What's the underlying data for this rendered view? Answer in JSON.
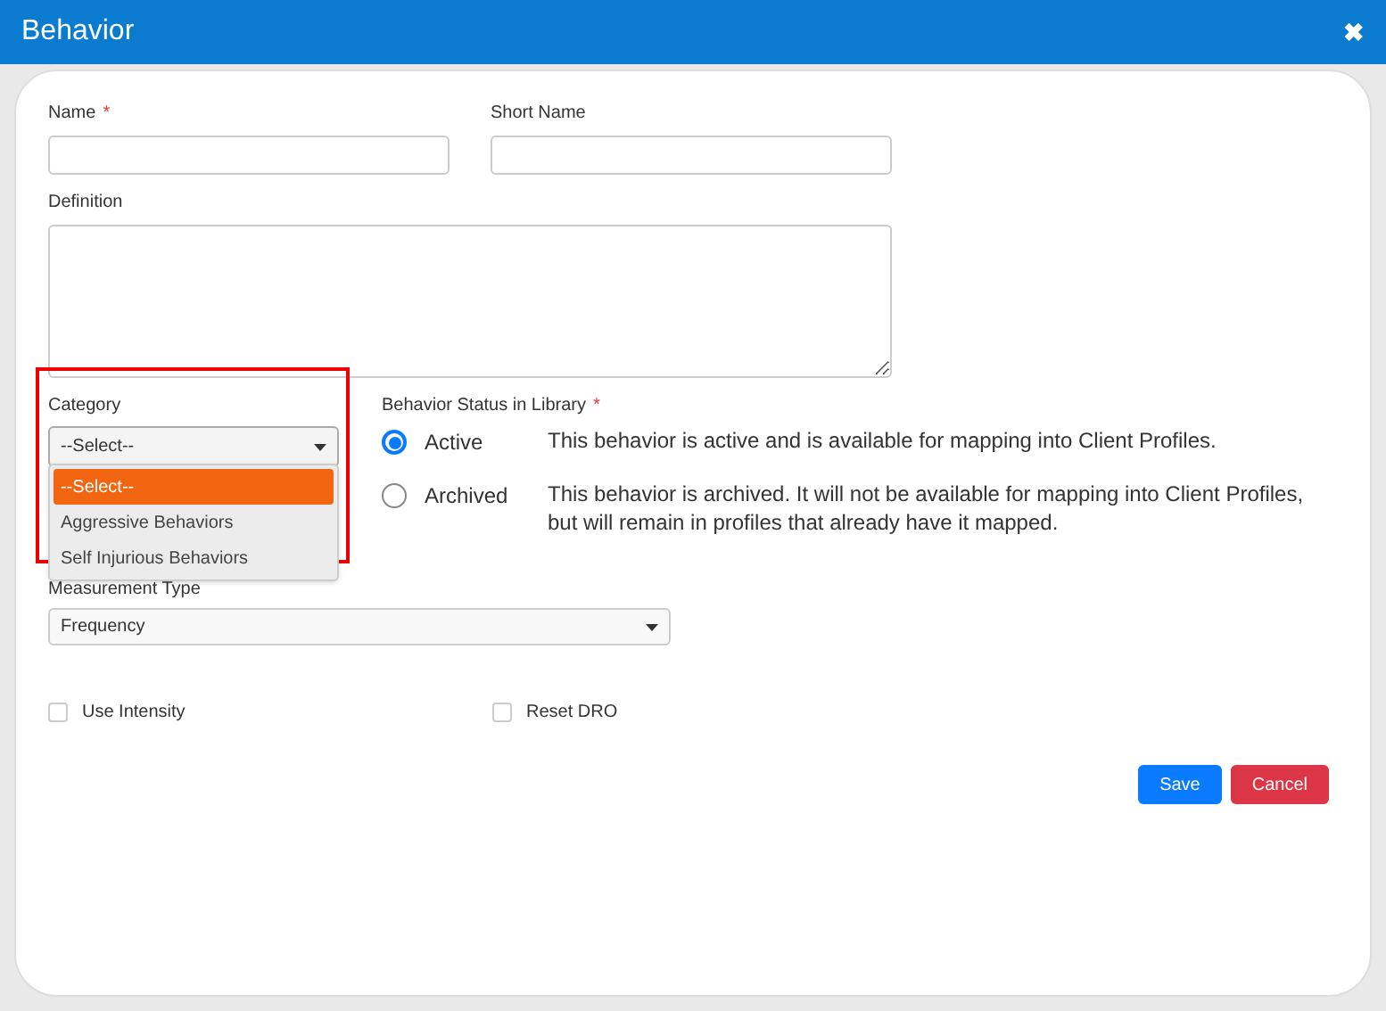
{
  "window": {
    "title": "Behavior",
    "close": "✖"
  },
  "fields": {
    "name": {
      "label": "Name",
      "required_mark": "*"
    },
    "short_name": {
      "label": "Short Name"
    },
    "definition": {
      "label": "Definition"
    }
  },
  "category": {
    "label": "Category",
    "value": "--Select--",
    "expanded": true,
    "options": [
      {
        "label": "--Select--",
        "selected": true
      },
      {
        "label": "Aggressive Behaviors",
        "selected": false
      },
      {
        "label": "Self Injurious Behaviors",
        "selected": false
      }
    ]
  },
  "status": {
    "label": "Behavior Status in Library",
    "required_mark": "*",
    "options": [
      {
        "label": "Active",
        "selected": true,
        "description": "This behavior is active and is available for mapping into Client Profiles."
      },
      {
        "label": "Archived",
        "selected": false,
        "description": "This behavior is archived. It will not be available for mapping into Client Profiles, but will remain in profiles that already have it mapped."
      }
    ]
  },
  "measurement_type": {
    "label": "Measurement Type",
    "value": "Frequency"
  },
  "checkboxes": [
    {
      "label": "Use Intensity",
      "checked": false
    },
    {
      "label": "Reset DRO",
      "checked": false
    }
  ],
  "buttons": [
    {
      "label": "Save",
      "kind": "primary"
    },
    {
      "label": "Cancel",
      "kind": "danger"
    }
  ]
}
